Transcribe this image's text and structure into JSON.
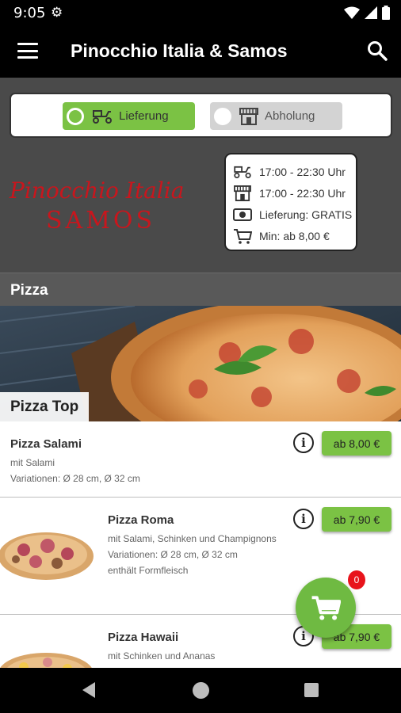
{
  "status_bar": {
    "time": "9:05"
  },
  "app_bar": {
    "title": "Pinocchio Italia & Samos"
  },
  "order_mode": {
    "delivery_label": "Lieferung",
    "pickup_label": "Abholung",
    "selected": "delivery"
  },
  "restaurant": {
    "logo_line1": "Pinocchio Italia",
    "logo_line2": "SAMOS"
  },
  "info": {
    "delivery_hours": "17:00 - 22:30 Uhr",
    "pickup_hours": "17:00 - 22:30 Uhr",
    "delivery_fee": "Lieferung: GRATIS",
    "minimum_order": "Min: ab 8,00 €"
  },
  "section": {
    "title": "Pizza"
  },
  "banner": {
    "label": "Pizza Top"
  },
  "menu_items": [
    {
      "name": "Pizza Salami",
      "description": "mit Salami",
      "variations": "Variationen: Ø 28 cm, Ø 32 cm",
      "note": "",
      "price": "ab 8,00 €"
    },
    {
      "name": "Pizza Roma",
      "description": "mit Salami, Schinken und Champignons",
      "variations": "Variationen: Ø 28 cm, Ø 32 cm",
      "note": "enthält Formfleisch",
      "price": "ab 7,90 €"
    },
    {
      "name": "Pizza Hawaii",
      "description": "mit Schinken und Ananas",
      "variations": "",
      "note": "",
      "price": "ab 7,90 €"
    }
  ],
  "cart": {
    "count": "0"
  },
  "colors": {
    "accent_green": "#7bc244",
    "badge_red": "#e8141c",
    "header_bg": "#000000",
    "panel_bg": "#4a4a4a"
  },
  "icons": [
    "gear-icon",
    "wifi-icon",
    "signal-icon",
    "battery-icon",
    "menu-icon",
    "search-icon",
    "scooter-icon",
    "shop-icon",
    "money-icon",
    "cart-icon",
    "info-icon"
  ]
}
